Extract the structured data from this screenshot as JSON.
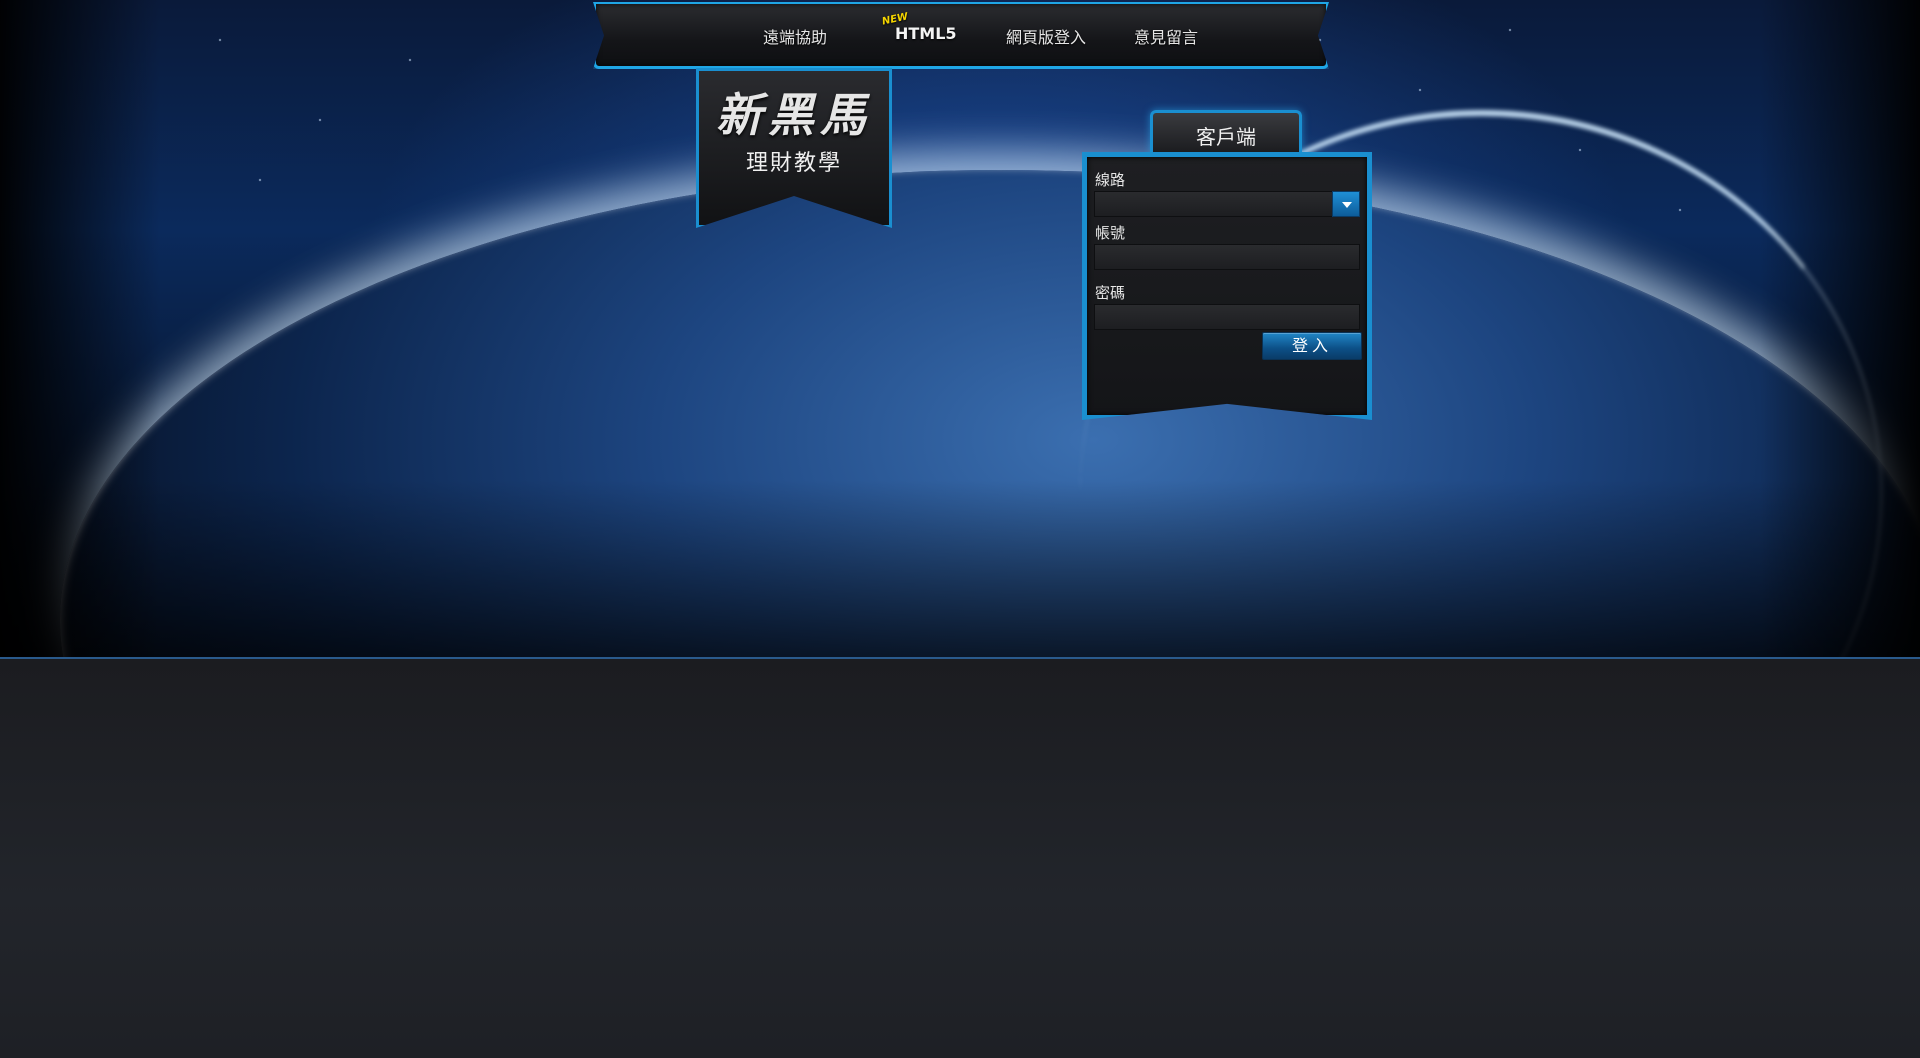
{
  "nav": {
    "items": [
      {
        "label": "遠端協助"
      },
      {
        "label": "HTML5",
        "badge": "NEW"
      },
      {
        "label": "網頁版登入"
      },
      {
        "label": "意見留言"
      }
    ]
  },
  "logo": {
    "main": "新黑馬",
    "sub": "理財教學"
  },
  "login": {
    "tab_label": "客戶端",
    "line_label": "線路",
    "line_value": "",
    "account_label": "帳號",
    "account_value": "",
    "password_label": "密碼",
    "password_value": "",
    "submit_label": "登入"
  },
  "colors": {
    "accent": "#1a8fd0",
    "button": "#0c4f86",
    "badge": "#f4d400"
  }
}
